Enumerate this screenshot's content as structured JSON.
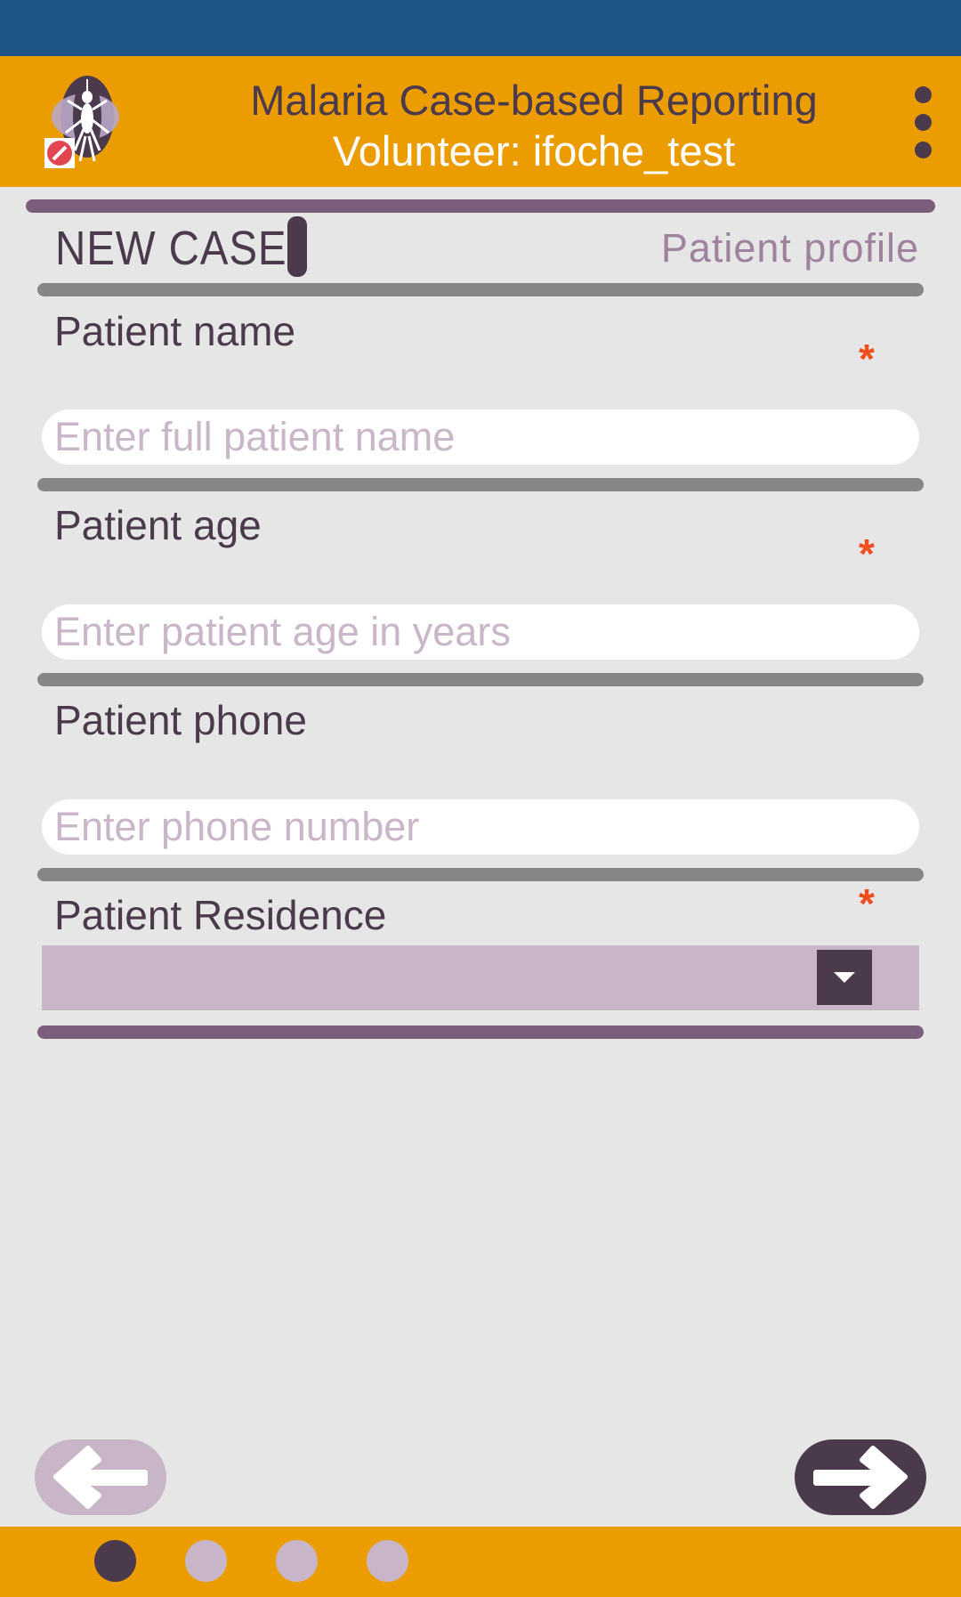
{
  "app": {
    "title": "Malaria Case-based Reporting",
    "subtitle": "Volunteer: ifoche_test"
  },
  "page": {
    "heading": "NEW CASE",
    "section": "Patient  profile"
  },
  "fields": {
    "name": {
      "label": "Patient name",
      "placeholder": "Enter full patient name",
      "value": "",
      "required": true
    },
    "age": {
      "label": "Patient age",
      "placeholder": "Enter patient age in years",
      "value": "",
      "required": true
    },
    "phone": {
      "label": "Patient phone",
      "placeholder": "Enter phone number",
      "value": "",
      "required": false
    },
    "residence": {
      "label": "Patient Residence",
      "selected": "",
      "required": true
    }
  },
  "required_mark": "*",
  "pagination": {
    "current": 1,
    "total": 4
  },
  "icons": {
    "logo": "mosquito-icon",
    "menu": "overflow-menu-icon",
    "dropdown": "caret-down-icon",
    "back": "arrow-left-icon",
    "next": "arrow-right-icon"
  },
  "colors": {
    "status_bar": "#1e5488",
    "app_bar": "#eb9c00",
    "primary": "#4a3a4c",
    "accent_light": "#c8b5c8",
    "divider_purple": "#7b5e7b",
    "divider_gray": "#868686",
    "required": "#f04e1a",
    "background": "#e6e6e6"
  }
}
